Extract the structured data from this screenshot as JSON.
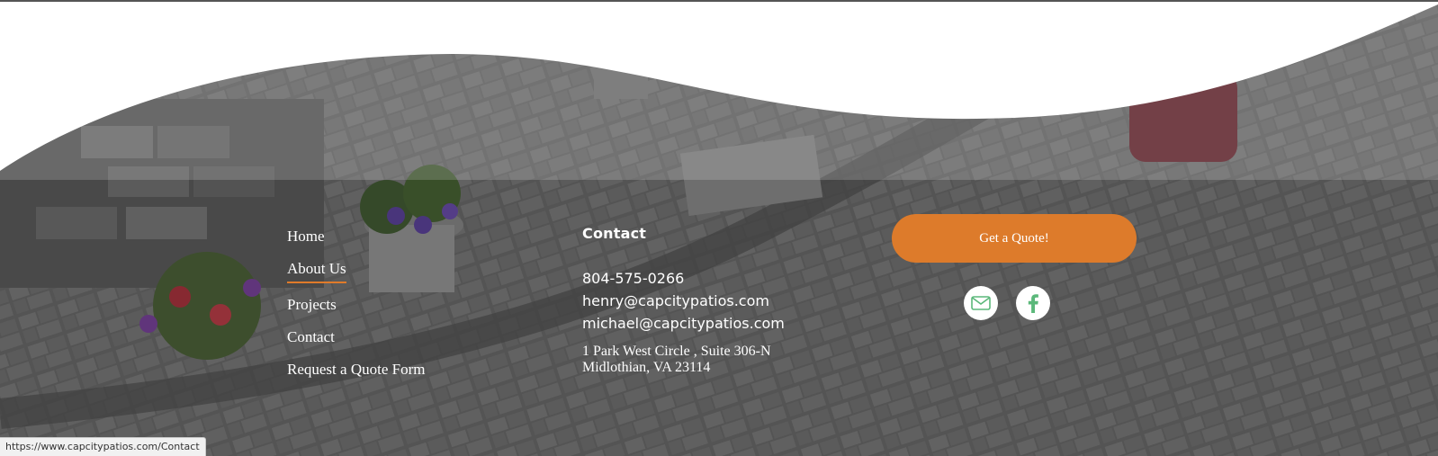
{
  "nav": {
    "items": [
      {
        "label": "Home",
        "active": false
      },
      {
        "label": "About Us",
        "active": true
      },
      {
        "label": "Projects",
        "active": false
      },
      {
        "label": "Contact",
        "active": false
      },
      {
        "label": "Request a Quote Form",
        "active": false
      }
    ]
  },
  "contact": {
    "heading": "Contact",
    "phone": "804-575-0266",
    "email1": "henry@capcitypatios.com",
    "email2": "michael@capcitypatios.com",
    "address_line1": "1 Park West Circle , Suite 306-N",
    "address_line2": "Midlothian, VA 23114"
  },
  "cta": {
    "quote_label": "Get a Quote!"
  },
  "social": {
    "icons": [
      "envelope-icon",
      "facebook-icon"
    ],
    "icon_color": "#5bb87a"
  },
  "status_bar": {
    "url": "https://www.capcitypatios.com/Contact"
  },
  "colors": {
    "accent": "#dd7b2b"
  }
}
